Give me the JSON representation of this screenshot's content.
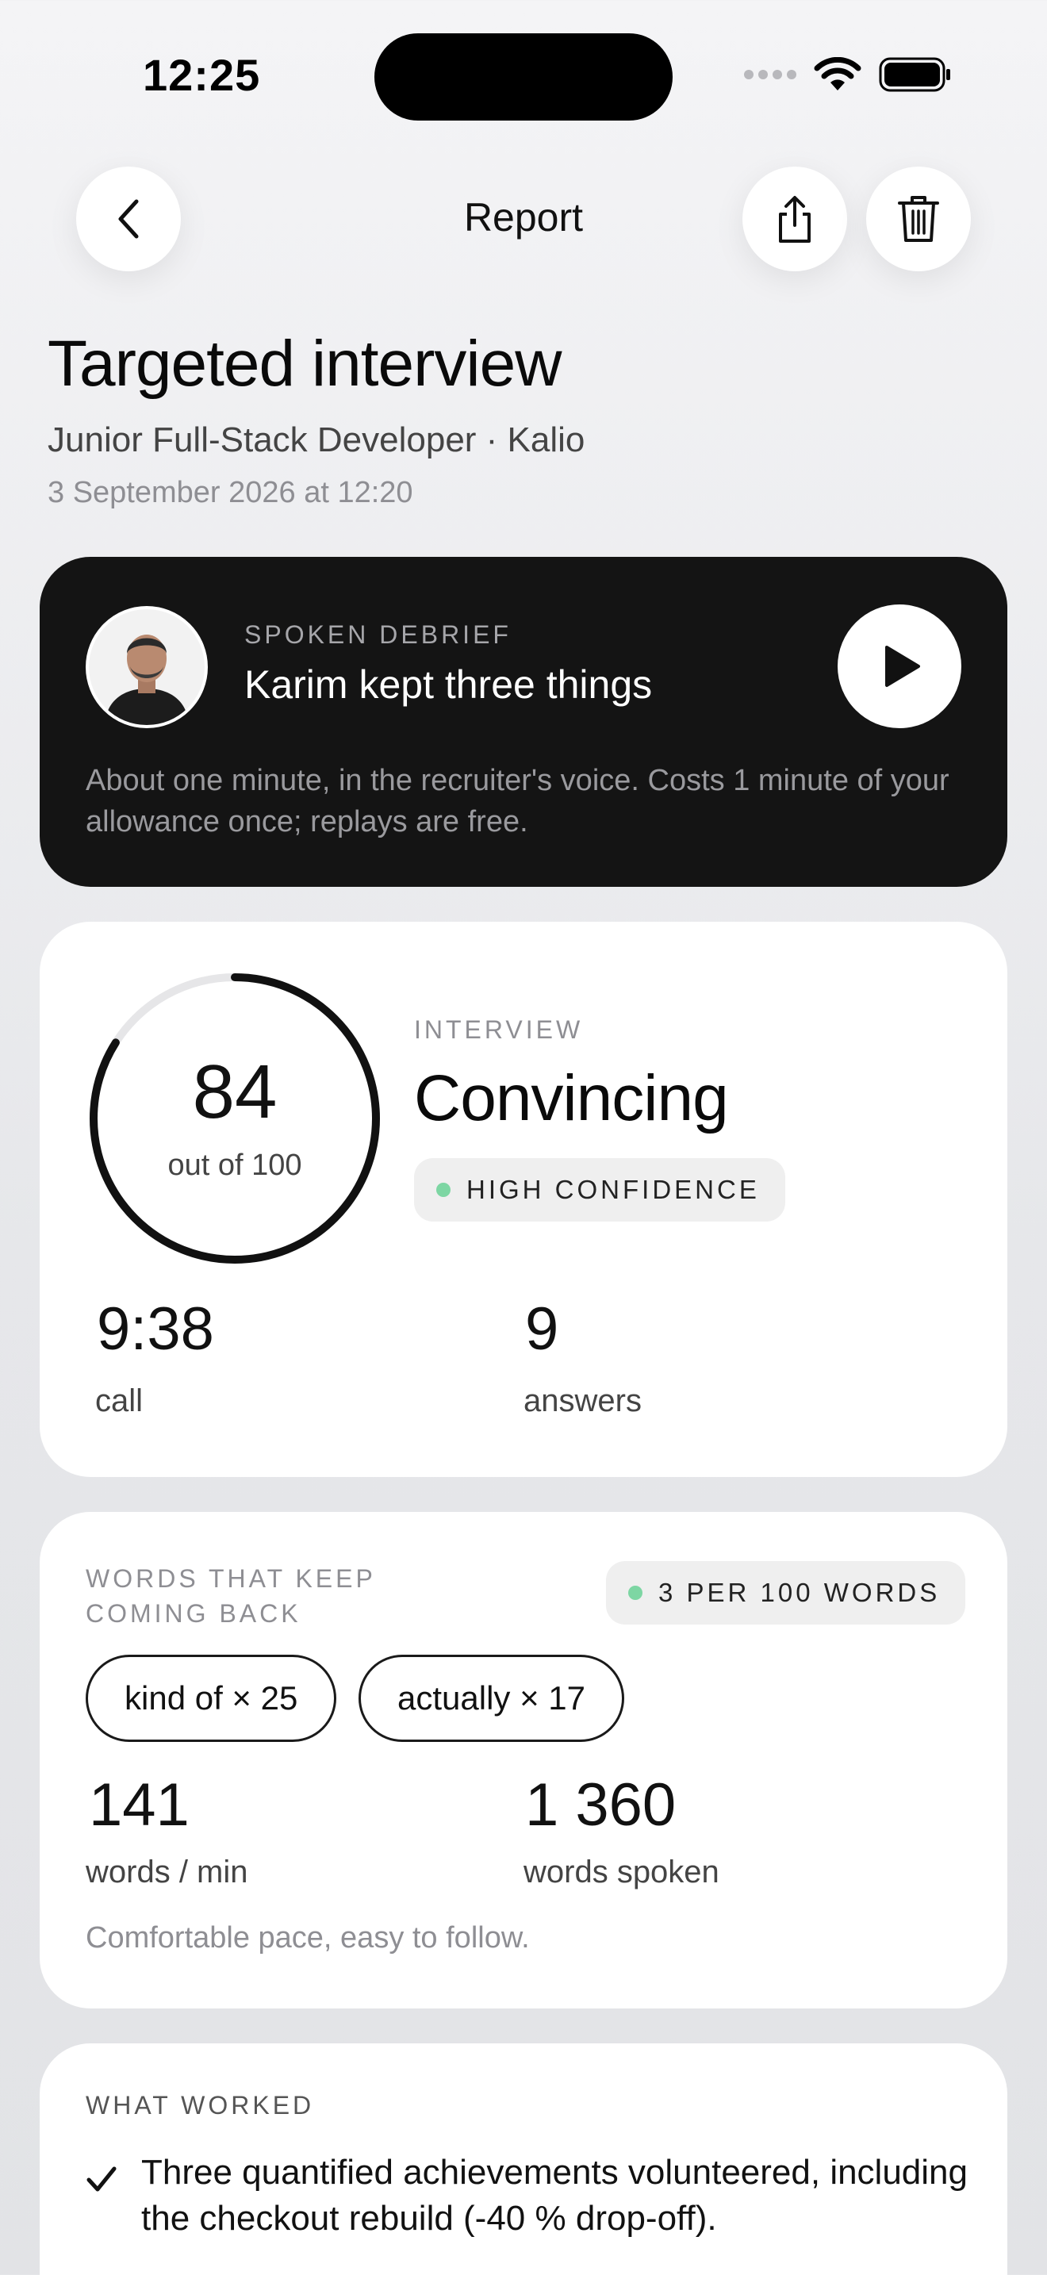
{
  "status_bar": {
    "time": "12:25"
  },
  "nav": {
    "title": "Report"
  },
  "header": {
    "title": "Targeted interview",
    "subtitle": "Junior Full-Stack Developer · Kalio",
    "date": "3 September 2026 at 12:20"
  },
  "debrief": {
    "kicker": "SPOKEN DEBRIEF",
    "title": "Karim kept three things",
    "description": "About one minute, in the recruiter's voice. Costs 1 minute of your allowance once; replays are free."
  },
  "score": {
    "value": "84",
    "out_of": "out of 100",
    "fraction": 0.84,
    "kicker": "INTERVIEW",
    "verdict": "Convincing",
    "confidence": "HIGH CONFIDENCE",
    "call_value": "9:38",
    "call_label": "call",
    "answers_value": "9",
    "answers_label": "answers"
  },
  "words": {
    "kicker": "WORDS THAT KEEP COMING BACK",
    "rate": "3 PER 100 WORDS",
    "chips": [
      "kind of × 25",
      "actually × 17"
    ],
    "wpm_value": "141",
    "wpm_label": "words / min",
    "spoken_value": "1 360",
    "spoken_label": "words spoken",
    "note": "Comfortable pace, easy to follow."
  },
  "worked": {
    "kicker": "WHAT WORKED",
    "items": [
      "Three quantified achievements volunteered, including the checkout rebuild (-40 % drop-off)."
    ]
  },
  "colors": {
    "accent_green": "#7dd6a3",
    "debrief_bg": "#141414"
  }
}
